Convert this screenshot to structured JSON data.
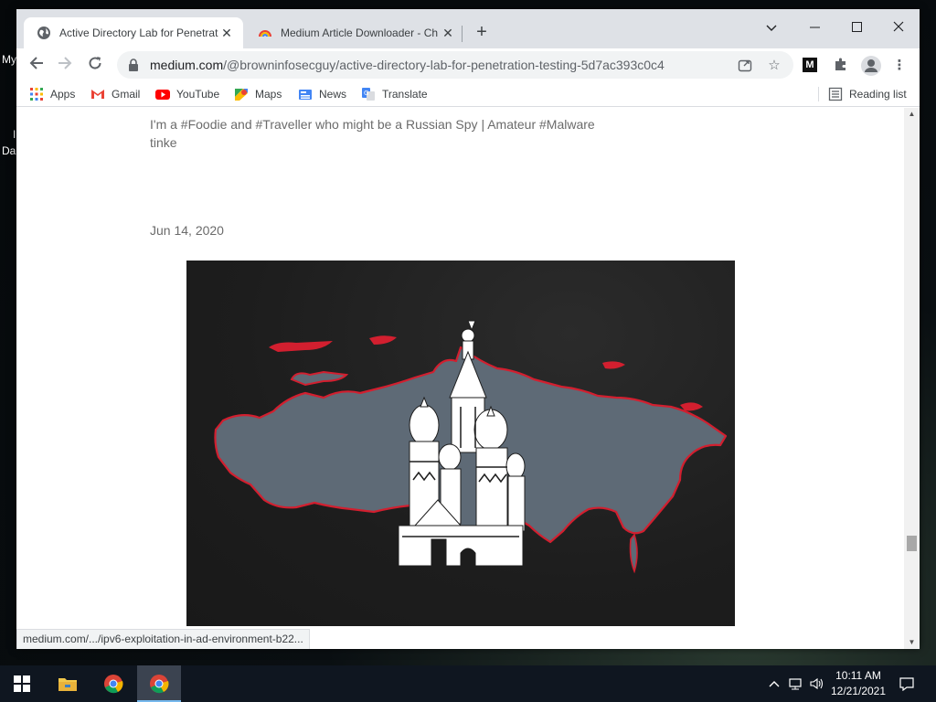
{
  "desktop": {
    "icon_labels": [
      "My",
      "I",
      "Da"
    ]
  },
  "browser": {
    "tabs": [
      {
        "title": "Active Directory Lab for Penetrat",
        "active": true
      },
      {
        "title": "Medium Article Downloader - Ch",
        "active": false
      }
    ],
    "url_host": "medium.com",
    "url_path": "/@browninfosecguy/active-directory-lab-for-penetration-testing-5d7ac393c0c4",
    "bookmarks": [
      {
        "label": "Apps",
        "icon": "apps-grid-icon"
      },
      {
        "label": "Gmail",
        "icon": "gmail-icon"
      },
      {
        "label": "YouTube",
        "icon": "youtube-icon"
      },
      {
        "label": "Maps",
        "icon": "maps-icon"
      },
      {
        "label": "News",
        "icon": "news-icon"
      },
      {
        "label": "Translate",
        "icon": "translate-icon"
      }
    ],
    "reading_list": "Reading list",
    "status_url": "medium.com/.../ipv6-exploitation-in-ad-environment-b22..."
  },
  "article": {
    "author_bio": "I'm a #Foodie and #Traveller who might be a Russian Spy | Amateur #Malware tinke",
    "date": "Jun 14, 2020"
  },
  "taskbar": {
    "time": "10:11 AM",
    "date": "12/21/2021"
  },
  "colors": {
    "accent": "#1a73e8",
    "map_fill": "#5e6a76",
    "map_outline": "#d21f2f",
    "hero_bg": "#1d1d1d"
  }
}
